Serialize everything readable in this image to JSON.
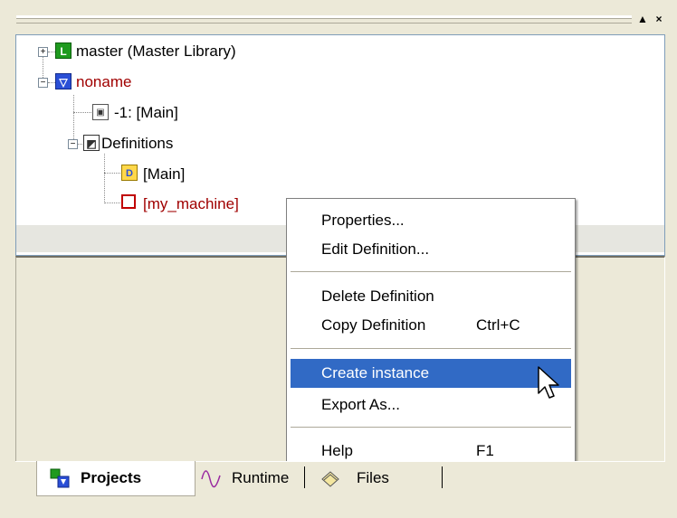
{
  "window": {
    "pin_glyph": "▲",
    "close_glyph": "×"
  },
  "tree": {
    "nodes": [
      {
        "label": "master (Master Library)",
        "icon": "library-icon",
        "expander": "+"
      },
      {
        "label": "noname",
        "icon": "project-icon",
        "expander": "−"
      },
      {
        "label": "-1: [Main]",
        "icon": "instance-icon"
      },
      {
        "label": "Definitions",
        "icon": "definitions-icon",
        "expander": "−"
      },
      {
        "label": "[Main]",
        "icon": "program-definition-icon"
      },
      {
        "label": "[my_machine]",
        "icon": "machine-definition-icon"
      }
    ]
  },
  "context_menu": {
    "items": [
      {
        "label": "Properties...",
        "shortcut": ""
      },
      {
        "label": "Edit Definition...",
        "shortcut": ""
      },
      {
        "label": "Delete Definition",
        "shortcut": ""
      },
      {
        "label": "Copy Definition",
        "shortcut": "Ctrl+C"
      },
      {
        "label": "Create instance",
        "shortcut": "",
        "highlighted": true
      },
      {
        "label": "Export As...",
        "shortcut": ""
      },
      {
        "label": "Help",
        "shortcut": "F1"
      }
    ],
    "highlight_color": "#316ac5"
  },
  "tabs": [
    {
      "label": "Projects",
      "icon": "projects-icon",
      "active": true
    },
    {
      "label": "Runtime",
      "icon": "runtime-icon",
      "active": false
    },
    {
      "label": "Files",
      "icon": "files-icon",
      "active": false
    }
  ]
}
